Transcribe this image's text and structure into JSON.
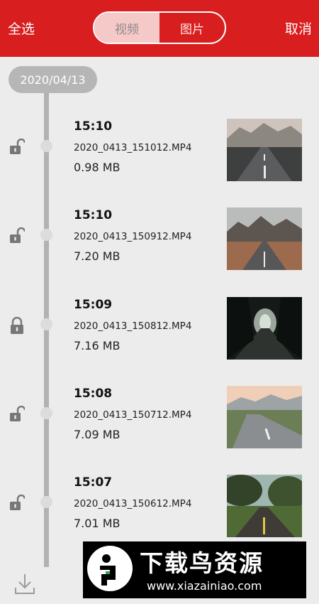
{
  "header": {
    "select_all": "全选",
    "cancel": "取消",
    "tabs": [
      {
        "label": "视频",
        "active": true
      },
      {
        "label": "图片",
        "active": false
      }
    ]
  },
  "date_group": "2020/04/13",
  "files": [
    {
      "time": "15:10",
      "name": "2020_0413_151012.MP4",
      "size": "0.98 MB",
      "locked": false,
      "thumb_icon": "mountain-road-thumbnail"
    },
    {
      "time": "15:10",
      "name": "2020_0413_150912.MP4",
      "size": "7.20 MB",
      "locked": false,
      "thumb_icon": "mountain-road-thumbnail"
    },
    {
      "time": "15:09",
      "name": "2020_0413_150812.MP4",
      "size": "7.16 MB",
      "locked": true,
      "thumb_icon": "forest-road-thumbnail"
    },
    {
      "time": "15:08",
      "name": "2020_0413_150712.MP4",
      "size": "7.09 MB",
      "locked": false,
      "thumb_icon": "coast-road-thumbnail"
    },
    {
      "time": "15:07",
      "name": "2020_0413_150612.MP4",
      "size": "7.01 MB",
      "locked": false,
      "thumb_icon": "tree-road-thumbnail"
    }
  ],
  "watermark": {
    "title": "下载鸟资源",
    "url": "www.xiazainiao.com"
  },
  "colors": {
    "header_red": "#d81e1e",
    "background": "#ececec",
    "timeline": "#b2b2b2"
  }
}
